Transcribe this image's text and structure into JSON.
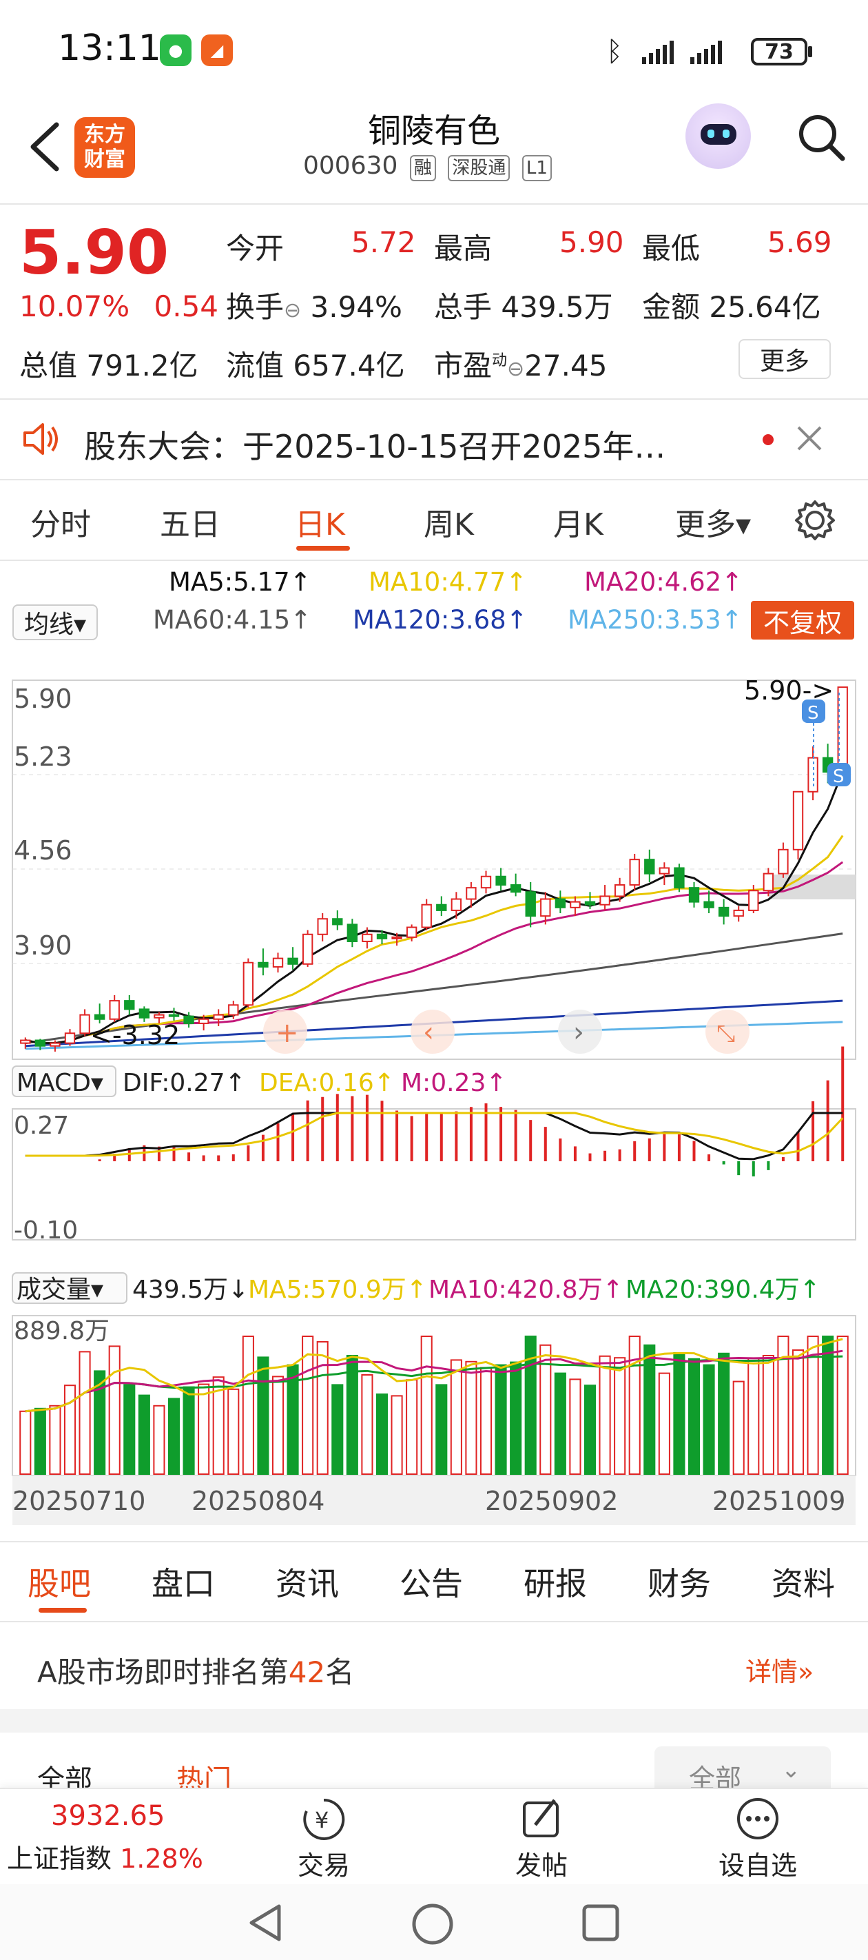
{
  "status_bar": {
    "time": "13:11",
    "battery": "73"
  },
  "header": {
    "name": "铜陵有色",
    "code": "000630",
    "tags": [
      "融",
      "深股通",
      "L1"
    ],
    "logo_line1": "东方",
    "logo_line2": "财富"
  },
  "quote": {
    "price": "5.90",
    "change_pct": "10.07%",
    "change_amt": "0.54",
    "open_label": "今开",
    "open": "5.72",
    "high_label": "最高",
    "high": "5.90",
    "low_label": "最低",
    "low": "5.69",
    "turnover_label": "换手",
    "turnover": "3.94%",
    "volume_label": "总手",
    "volume": "439.5万",
    "amount_label": "金额",
    "amount": "25.64亿",
    "total_cap_label": "总值",
    "total_cap": "791.2亿",
    "float_cap_label": "流值",
    "float_cap": "657.4亿",
    "pe_label": "市盈",
    "pe_sup": "动",
    "pe": "27.45",
    "more_label": "更多"
  },
  "notice": {
    "text": "股东大会：于2025-10-15召开2025年…"
  },
  "kline_tabs": [
    {
      "label": "分时"
    },
    {
      "label": "五日"
    },
    {
      "label": "日K"
    },
    {
      "label": "周K"
    },
    {
      "label": "月K"
    },
    {
      "label": "更多▾"
    }
  ],
  "ma_legend": {
    "selector": "均线▾",
    "ma5": "MA5:5.17↑",
    "ma10": "MA10:4.77↑",
    "ma20": "MA20:4.62↑",
    "ma60": "MA60:4.15↑",
    "ma120": "MA120:3.68↑",
    "ma250": "MA250:3.53↑",
    "adjust": "不复权"
  },
  "colors": {
    "accent": "#e64a19",
    "up": "#e02424",
    "down": "#0f9d2c",
    "ma5": "#111111",
    "ma10": "#e8c600",
    "ma20": "#c2187a",
    "ma60": "#555555",
    "ma120": "#1e3aa8",
    "ma250": "#5fb4e8"
  },
  "chart_data": {
    "type": "candlestick",
    "y_ticks": [
      "5.90",
      "5.23",
      "4.56",
      "3.90"
    ],
    "last_price_marker": "5.90->",
    "low_marker": "<-3.32",
    "x_ticks": [
      "20250710",
      "20250804",
      "20250902",
      "20251009"
    ],
    "candles": [
      [
        3.38,
        3.42,
        3.34,
        3.4
      ],
      [
        3.4,
        3.41,
        3.33,
        3.36
      ],
      [
        3.36,
        3.4,
        3.32,
        3.38
      ],
      [
        3.38,
        3.48,
        3.36,
        3.45
      ],
      [
        3.45,
        3.62,
        3.43,
        3.58
      ],
      [
        3.58,
        3.66,
        3.52,
        3.55
      ],
      [
        3.55,
        3.72,
        3.53,
        3.68
      ],
      [
        3.68,
        3.72,
        3.58,
        3.62
      ],
      [
        3.62,
        3.64,
        3.53,
        3.56
      ],
      [
        3.56,
        3.6,
        3.52,
        3.58
      ],
      [
        3.58,
        3.63,
        3.54,
        3.57
      ],
      [
        3.57,
        3.6,
        3.49,
        3.52
      ],
      [
        3.52,
        3.58,
        3.47,
        3.55
      ],
      [
        3.55,
        3.62,
        3.5,
        3.58
      ],
      [
        3.58,
        3.68,
        3.55,
        3.65
      ],
      [
        3.65,
        3.98,
        3.63,
        3.95
      ],
      [
        3.95,
        4.05,
        3.86,
        3.92
      ],
      [
        3.92,
        4.02,
        3.88,
        3.98
      ],
      [
        3.98,
        4.06,
        3.9,
        3.94
      ],
      [
        3.94,
        4.18,
        3.92,
        4.15
      ],
      [
        4.15,
        4.3,
        4.1,
        4.26
      ],
      [
        4.26,
        4.32,
        4.18,
        4.22
      ],
      [
        4.22,
        4.26,
        4.06,
        4.1
      ],
      [
        4.1,
        4.2,
        4.05,
        4.15
      ],
      [
        4.15,
        4.18,
        4.08,
        4.12
      ],
      [
        4.12,
        4.16,
        4.07,
        4.13
      ],
      [
        4.13,
        4.22,
        4.1,
        4.2
      ],
      [
        4.2,
        4.4,
        4.18,
        4.36
      ],
      [
        4.36,
        4.42,
        4.28,
        4.32
      ],
      [
        4.32,
        4.45,
        4.26,
        4.4
      ],
      [
        4.4,
        4.52,
        4.34,
        4.48
      ],
      [
        4.48,
        4.6,
        4.44,
        4.56
      ],
      [
        4.56,
        4.62,
        4.46,
        4.5
      ],
      [
        4.5,
        4.58,
        4.42,
        4.45
      ],
      [
        4.45,
        4.52,
        4.2,
        4.28
      ],
      [
        4.28,
        4.45,
        4.22,
        4.4
      ],
      [
        4.4,
        4.46,
        4.3,
        4.34
      ],
      [
        4.34,
        4.42,
        4.28,
        4.38
      ],
      [
        4.38,
        4.45,
        4.33,
        4.36
      ],
      [
        4.36,
        4.5,
        4.32,
        4.42
      ],
      [
        4.42,
        4.55,
        4.38,
        4.5
      ],
      [
        4.5,
        4.72,
        4.46,
        4.68
      ],
      [
        4.68,
        4.75,
        4.52,
        4.58
      ],
      [
        4.58,
        4.66,
        4.5,
        4.62
      ],
      [
        4.62,
        4.65,
        4.45,
        4.48
      ],
      [
        4.48,
        4.52,
        4.34,
        4.38
      ],
      [
        4.38,
        4.46,
        4.3,
        4.34
      ],
      [
        4.34,
        4.4,
        4.22,
        4.28
      ],
      [
        4.28,
        4.35,
        4.24,
        4.32
      ],
      [
        4.32,
        4.5,
        4.3,
        4.46
      ],
      [
        4.46,
        4.62,
        4.42,
        4.58
      ],
      [
        4.58,
        4.8,
        4.55,
        4.75
      ],
      [
        4.75,
        4.88,
        4.68,
        5.16
      ],
      [
        5.16,
        5.48,
        5.1,
        5.4
      ],
      [
        5.4,
        5.5,
        5.22,
        5.3
      ],
      [
        5.3,
        5.9,
        5.28,
        5.9
      ]
    ],
    "macd": {
      "dif": "0.27↑",
      "dea": "0.16↑",
      "m": "0.23↑",
      "labels": [
        "MACD▾",
        "DIF:0.27↑",
        "DEA:0.16↑",
        "M:0.23↑"
      ],
      "y_ticks": [
        "0.27",
        "-0.10"
      ]
    },
    "volume": {
      "current": "439.5万↓",
      "ma5": "MA5:570.9万↑",
      "ma10": "MA10:420.8万↑",
      "ma20": "MA20:390.4万↑",
      "selector": "成交量▾",
      "y_max_label": "889.8万"
    }
  },
  "bottom_tabs": [
    {
      "label": "股吧"
    },
    {
      "label": "盘口"
    },
    {
      "label": "资讯"
    },
    {
      "label": "公告"
    },
    {
      "label": "研报"
    },
    {
      "label": "财务"
    },
    {
      "label": "资料"
    }
  ],
  "rank": {
    "prefix": "A股市场即时排名第",
    "number": "42",
    "suffix": "名",
    "detail": "详情"
  },
  "filter": {
    "all": "全部",
    "hot": "热门",
    "dropdown": "全部"
  },
  "bottom_bar": {
    "index_value": "3932.65",
    "index_name": "上证指数",
    "index_pct": "1.28%",
    "trade": "交易",
    "post": "发帖",
    "watch": "设自选"
  }
}
